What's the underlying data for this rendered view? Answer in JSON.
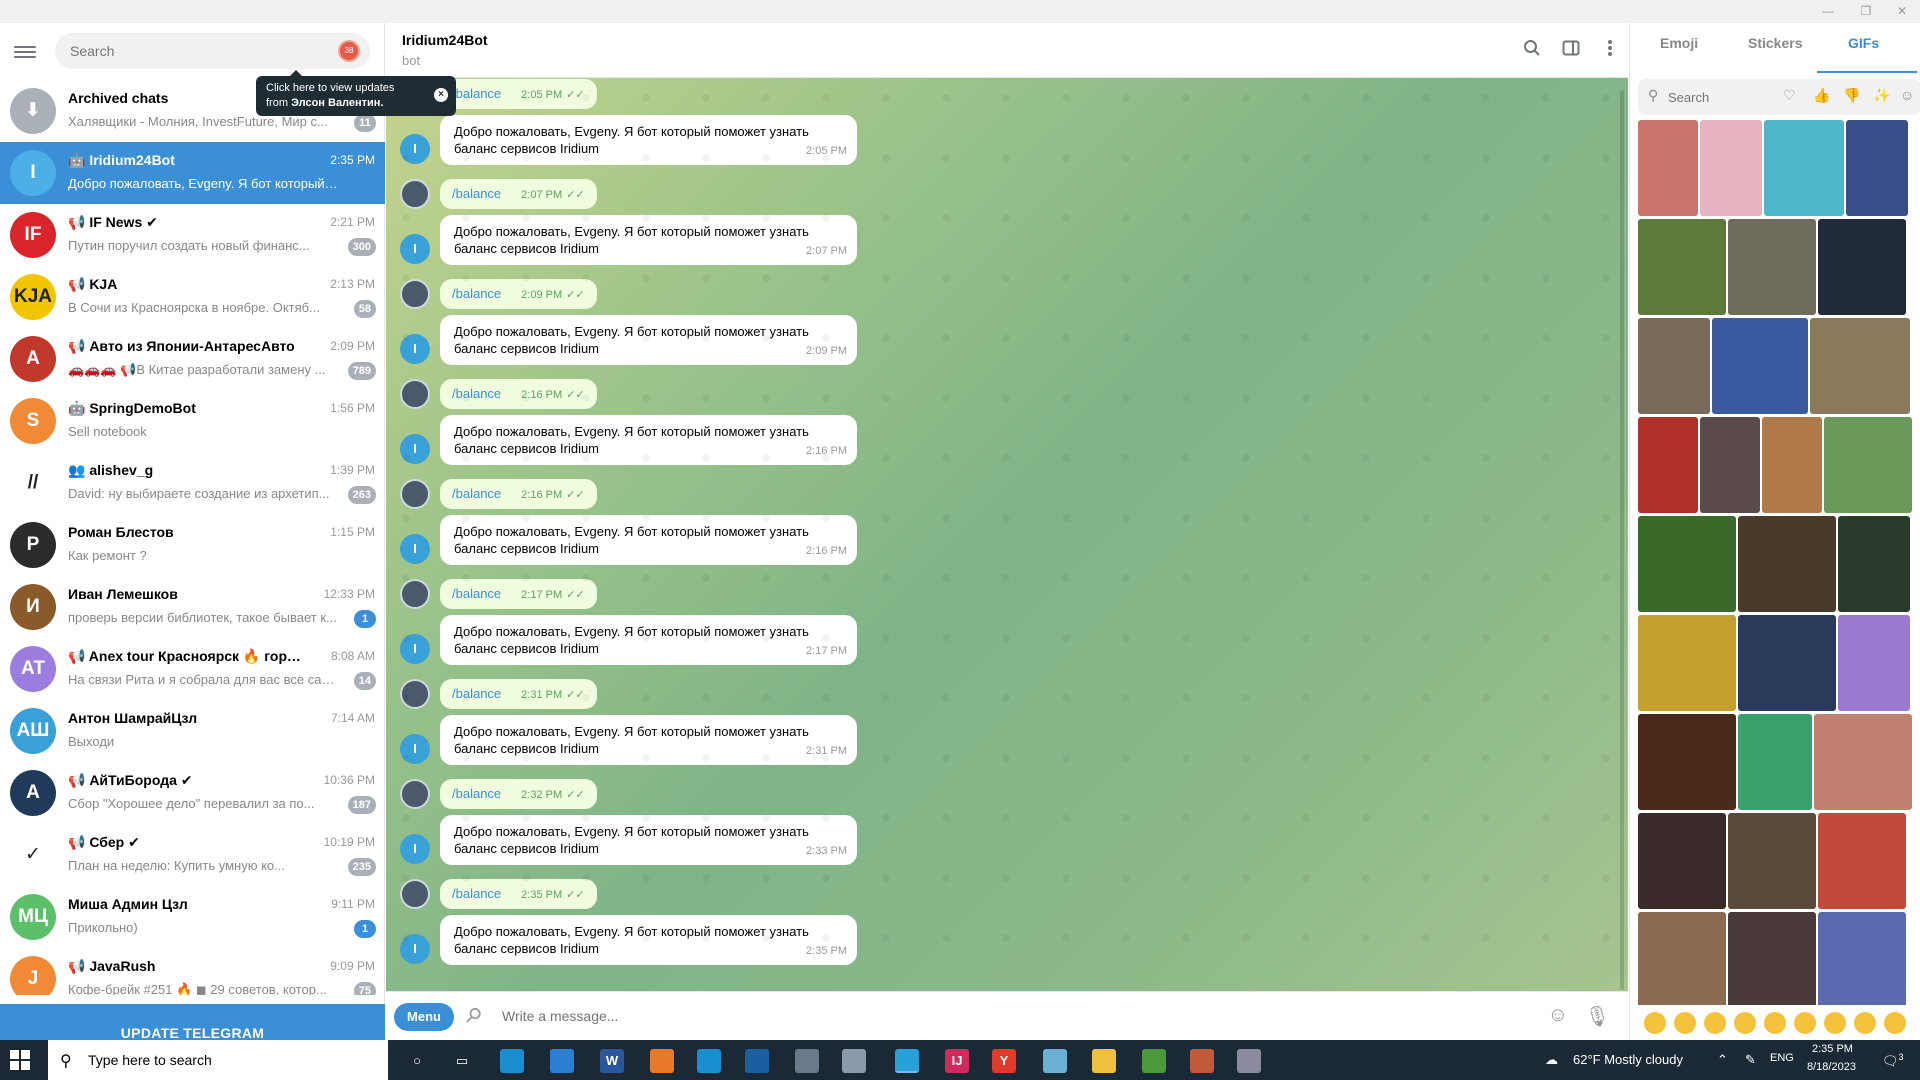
{
  "window": {
    "minimize": "—",
    "restore": "❐",
    "close": "✕"
  },
  "sidebar": {
    "search_placeholder": "Search",
    "spam_badge": "38",
    "tooltip": {
      "line1": "Click here to view updates",
      "line2_prefix": "from ",
      "line2_name": "Элсон Валентин."
    },
    "update_button": "UPDATE TELEGRAM",
    "chats": [
      {
        "name": "Archived chats",
        "preview": "Халявщики - Молния, InvestFuture, Мир с...",
        "time": "",
        "badge": "11",
        "avatar": "⬇",
        "avatar_color": "#a9b0b7"
      },
      {
        "name": "🤖 Iridium24Bot",
        "preview": "Добро пожаловать, Evgeny. Я бот который пом...",
        "time": "2:35 PM",
        "badge": "",
        "avatar": "I",
        "avatar_color": "#4cb0e6",
        "active": true
      },
      {
        "name": "📢 IF News ✔",
        "preview": "Путин поручил создать новый финанс...",
        "time": "2:21 PM",
        "badge": "300",
        "avatar": "IF",
        "avatar_color": "#d9252a"
      },
      {
        "name": "📢 KJA",
        "preview": "В Сочи из Красноярска в ноябре. Октяб...",
        "time": "2:13 PM",
        "badge": "58",
        "avatar": "KJA",
        "avatar_color": "#f3c500"
      },
      {
        "name": "📢 Авто из Японии-АнтаресАвто",
        "preview": "🚗🚗🚗 📢В Китае разработали замену ...",
        "time": "2:09 PM",
        "badge": "789",
        "avatar": "A",
        "avatar_color": "#c0392b"
      },
      {
        "name": "🤖 SpringDemoBot",
        "preview": "Sell notebook",
        "time": "1:56 PM",
        "badge": "",
        "avatar": "S",
        "avatar_color": "#f08a36"
      },
      {
        "name": "👥 alishev_g",
        "preview": "David: ну выбираете создание из архетип...",
        "time": "1:39 PM",
        "badge": "263",
        "avatar": "//",
        "avatar_color": "#ffffff"
      },
      {
        "name": "Роман Блестов",
        "preview": "Как ремонт ?",
        "time": "1:15 PM",
        "badge": "",
        "avatar": "Р",
        "avatar_color": "#2b2b2b"
      },
      {
        "name": "Иван Лемешков",
        "preview": "проверь версии библиотек, такое бывает к...",
        "time": "12:33 PM",
        "badge": "1",
        "avatar": "И",
        "avatar_color": "#8a5a2b",
        "unread": true
      },
      {
        "name": "📢 Anex tour Красноярск 🔥 горящие ...",
        "preview": "На связи Рита и я собрала для вас все самы...",
        "time": "8:08 AM",
        "badge": "14",
        "avatar": "AT",
        "avatar_color": "#9b7de0"
      },
      {
        "name": "Антон ШамрайЦзл",
        "preview": "Выходи",
        "time": "7:14 AM",
        "badge": "",
        "avatar": "АШ",
        "avatar_color": "#3aa0d8"
      },
      {
        "name": "📢 АйТиБорода ✔",
        "preview": "Сбор \"Хорошее дело\" перевалил за по...",
        "time": "10:36 PM",
        "badge": "187",
        "avatar": "А",
        "avatar_color": "#1f3a5a"
      },
      {
        "name": "📢 Сбер ✔",
        "preview": "План на неделю:     Купить умную ко...",
        "time": "10:19 PM",
        "badge": "235",
        "avatar": "✓",
        "avatar_color": "#ffffff"
      },
      {
        "name": "Миша Админ Цзл",
        "preview": "Прикольно)",
        "time": "9:11 PM",
        "badge": "1",
        "avatar": "МЦ",
        "avatar_color": "#5cbf6a",
        "unread": true
      },
      {
        "name": "📢 JavaRush",
        "preview": "Кофе-брейк #251 🔥 ◼ 29 советов, котор...",
        "time": "9:09 PM",
        "badge": "75",
        "avatar": "J",
        "avatar_color": "#f08a36"
      }
    ]
  },
  "chat": {
    "title": "Iridium24Bot",
    "subtitle": "bot",
    "bot_text_line1": "Добро пожаловать, Evgeny. Я бот который поможет узнать",
    "bot_text_line2": "баланс сервисов Iridium",
    "messages": [
      {
        "cmd": "/balance",
        "cmd_time": "2:05 PM",
        "bot_time": "2:05 PM"
      },
      {
        "cmd": "/balance",
        "cmd_time": "2:07 PM",
        "bot_time": "2:07 PM"
      },
      {
        "cmd": "/balance",
        "cmd_time": "2:09 PM",
        "bot_time": "2:09 PM"
      },
      {
        "cmd": "/balance",
        "cmd_time": "2:16 PM",
        "bot_time": "2:16 PM"
      },
      {
        "cmd": "/balance",
        "cmd_time": "2:16 PM",
        "bot_time": "2:16 PM"
      },
      {
        "cmd": "/balance",
        "cmd_time": "2:17 PM",
        "bot_time": "2:17 PM"
      },
      {
        "cmd": "/balance",
        "cmd_time": "2:31 PM",
        "bot_time": "2:31 PM"
      },
      {
        "cmd": "/balance",
        "cmd_time": "2:32 PM",
        "bot_time": "2:33 PM"
      },
      {
        "cmd": "/balance",
        "cmd_time": "2:35 PM",
        "bot_time": "2:35 PM"
      }
    ],
    "compose": {
      "menu_label": "Menu",
      "placeholder": "Write a message..."
    }
  },
  "panel": {
    "tabs": [
      "Emoji",
      "Stickers",
      "GIFs"
    ],
    "active_tab": "GIFs",
    "search_placeholder": "Search",
    "gif_colors": [
      "#c9756b",
      "#e6b4c0",
      "#4fb6c8",
      "#3a4f8a",
      "#5c7a3a",
      "#6e6a5c",
      "#1f2a3a",
      "#7a6a5a",
      "#3a5aa0",
      "#8a7a5a",
      "#b0302a",
      "#5a4a4a",
      "#b07a4a",
      "#6a9a5a",
      "#3a6a2a",
      "#4a3a2a",
      "#2a3a2a",
      "#c4a030",
      "#2a3a5a",
      "#9a7ad0",
      "#4a2a1a",
      "#3aa06a",
      "#c08070",
      "#3a2a2a",
      "#5a4a3a",
      "#c04a3a",
      "#8a6a50",
      "#4a3a3a",
      "#5a6ab0"
    ]
  },
  "taskbar": {
    "search_placeholder": "Type here to search",
    "weather": "62°F  Mostly cloudy",
    "lang": "ENG",
    "time": "2:35 PM",
    "date": "8/18/2023",
    "notifications": "3"
  }
}
